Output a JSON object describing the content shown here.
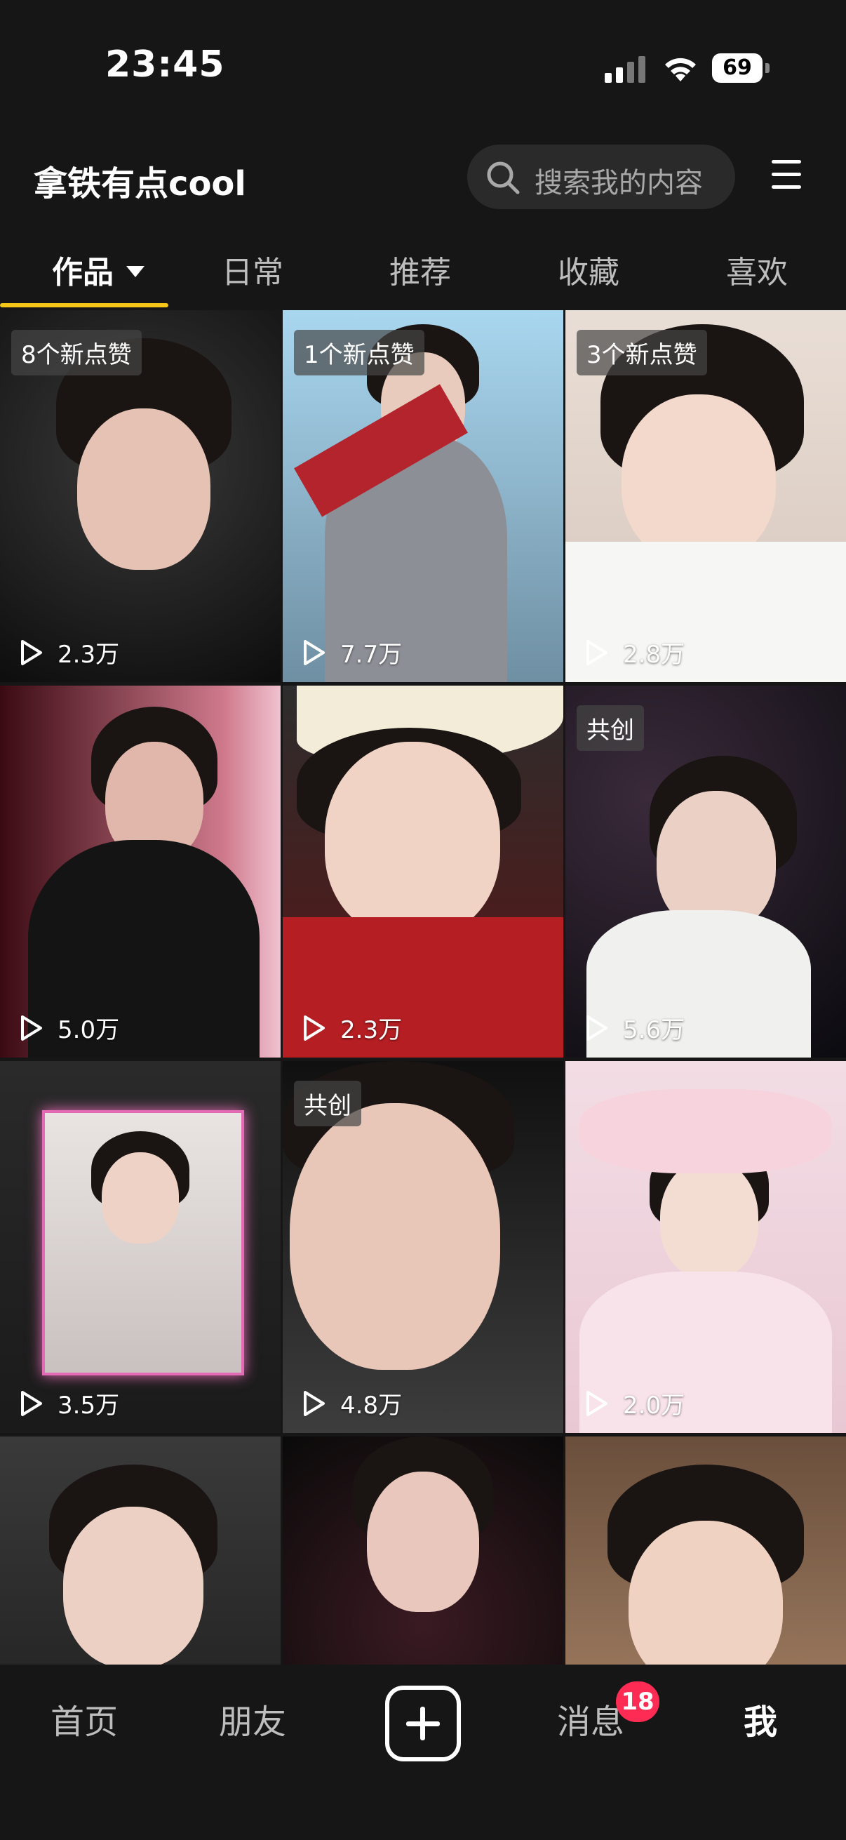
{
  "status_bar": {
    "time": "23:45",
    "battery": "69"
  },
  "header": {
    "username": "拿铁有点cool",
    "search_placeholder": "搜索我的内容"
  },
  "tabs": [
    {
      "label": "作品"
    },
    {
      "label": "日常"
    },
    {
      "label": "推荐"
    },
    {
      "label": "收藏"
    },
    {
      "label": "喜欢"
    }
  ],
  "grid": [
    {
      "badge": "8个新点赞",
      "plays": "2.3万"
    },
    {
      "badge": "1个新点赞",
      "plays": "7.7万"
    },
    {
      "badge": "3个新点赞",
      "plays": "2.8万"
    },
    {
      "badge": "",
      "plays": "5.0万"
    },
    {
      "badge": "",
      "plays": "2.3万"
    },
    {
      "badge": "共创",
      "plays": "5.6万"
    },
    {
      "badge": "",
      "plays": "3.5万"
    },
    {
      "badge": "共创",
      "plays": "4.8万"
    },
    {
      "badge": "",
      "plays": "2.0万"
    },
    {
      "badge": "",
      "plays": ""
    },
    {
      "badge": "",
      "plays": ""
    },
    {
      "badge": "",
      "plays": ""
    }
  ],
  "bottom_nav": {
    "home": "首页",
    "friends": "朋友",
    "messages": "消息",
    "messages_badge": "18",
    "me": "我"
  },
  "colors": {
    "accent_underline": "#f5c518",
    "badge_red": "#fe2c55"
  }
}
